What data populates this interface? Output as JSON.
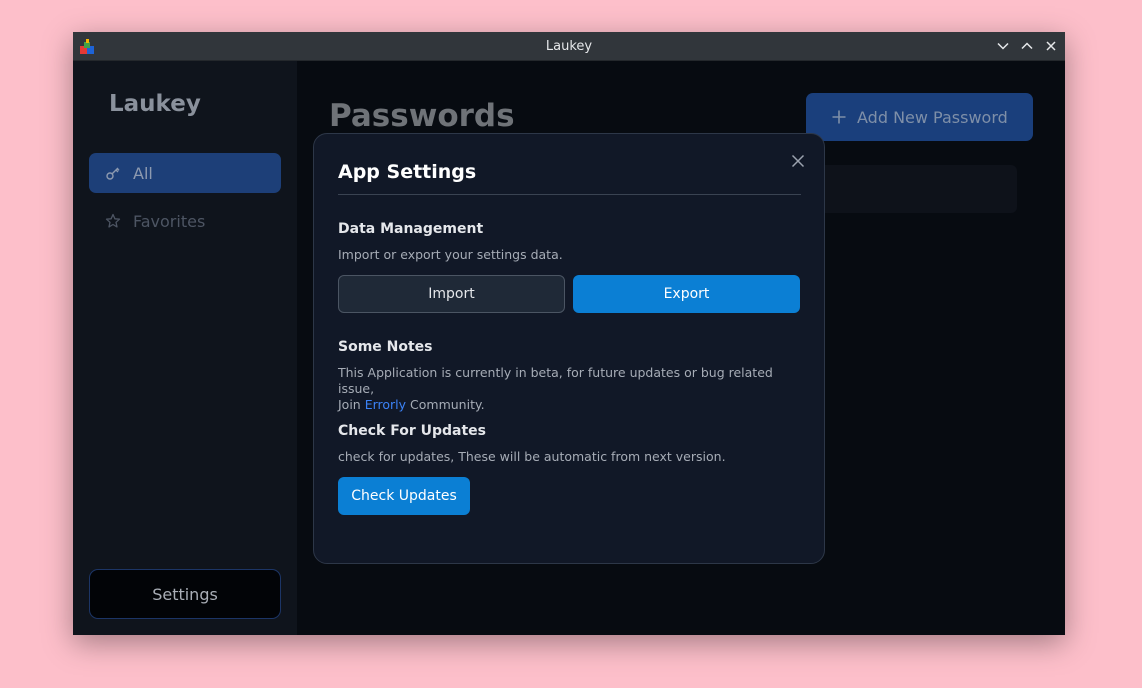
{
  "window": {
    "title": "Laukey"
  },
  "sidebar": {
    "brand": "Laukey",
    "items": [
      {
        "label": "All",
        "icon": "key-icon",
        "active": true
      },
      {
        "label": "Favorites",
        "icon": "star-icon",
        "active": false
      }
    ],
    "settings_label": "Settings"
  },
  "main": {
    "title": "Passwords",
    "add_button_label": "Add New Password"
  },
  "modal": {
    "title": "App Settings",
    "data_management": {
      "heading": "Data Management",
      "description": "Import or export your settings data.",
      "import_label": "Import",
      "export_label": "Export"
    },
    "notes": {
      "heading": "Some Notes",
      "text_line1": "This Application is currently in beta, for future updates or bug related issue,",
      "text_join": "Join ",
      "link_text": "Errorly",
      "text_after_link": " Community."
    },
    "updates": {
      "heading": "Check For Updates",
      "description": "check for updates, These will be automatic from next version.",
      "button_label": "Check Updates"
    }
  },
  "colors": {
    "accent": "#0b7fd4",
    "link": "#3b82f6",
    "modal_bg": "#111827",
    "window_bg": "#070b11",
    "desktop_bg": "#fdbfca"
  }
}
